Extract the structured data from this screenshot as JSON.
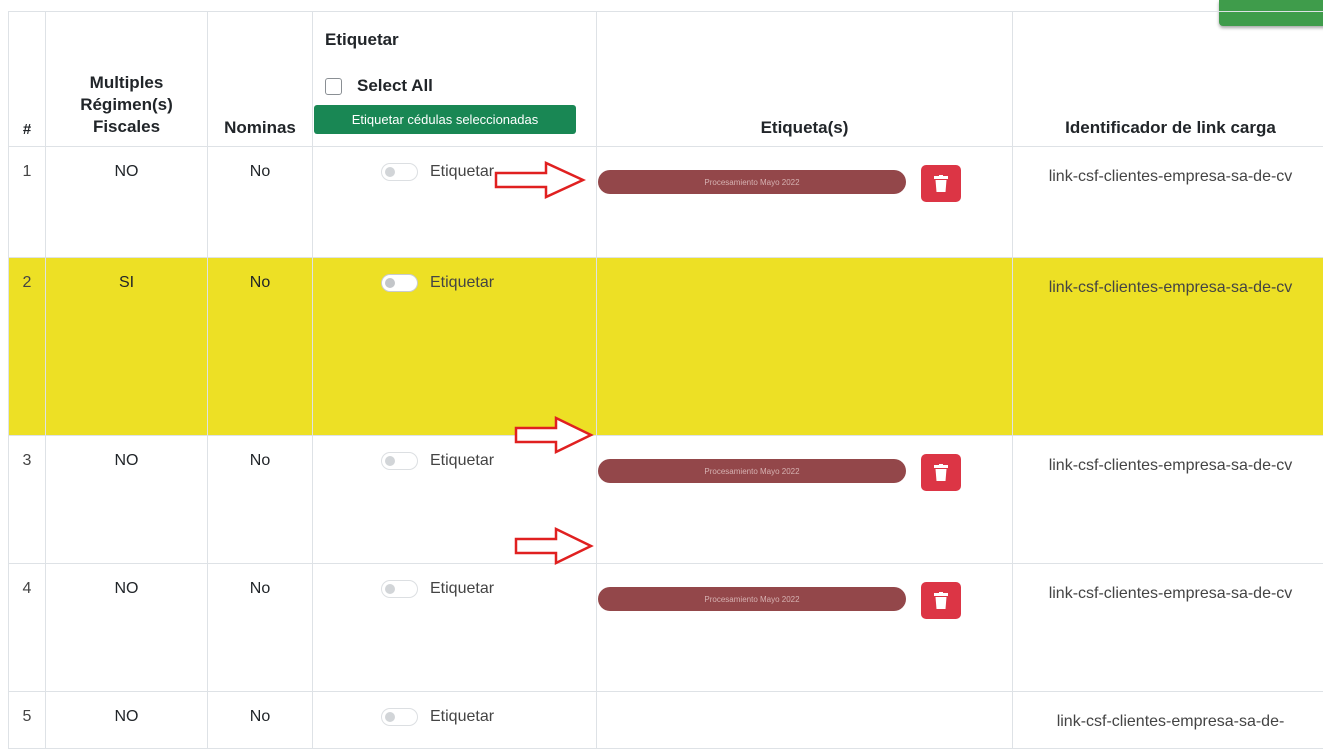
{
  "table": {
    "headers": {
      "num": "#",
      "regimen": "Multiples Régimen(s) Fiscales",
      "nominas": "Nominas",
      "etiquetar_title": "Etiquetar",
      "select_all": "Select All",
      "tag_selected_button": "Etiquetar cédulas seleccionadas",
      "etiquetas": "Etiqueta(s)",
      "identificador": "Identificador de link carga"
    },
    "rows": [
      {
        "num": "1",
        "regimen": "NO",
        "nominas": "No",
        "toggle_label": "Etiquetar",
        "tag": "Procesamiento Mayo 2022",
        "link": "link-csf-clientes-empresa-sa-de-cv"
      },
      {
        "num": "2",
        "regimen": "SI",
        "nominas": "No",
        "toggle_label": "Etiquetar",
        "tag": "",
        "link": "link-csf-clientes-empresa-sa-de-cv"
      },
      {
        "num": "3",
        "regimen": "NO",
        "nominas": "No",
        "toggle_label": "Etiquetar",
        "tag": "Procesamiento Mayo 2022",
        "link": "link-csf-clientes-empresa-sa-de-cv"
      },
      {
        "num": "4",
        "regimen": "NO",
        "nominas": "No",
        "toggle_label": "Etiquetar",
        "tag": "Procesamiento Mayo 2022",
        "link": "link-csf-clientes-empresa-sa-de-cv"
      },
      {
        "num": "5",
        "regimen": "NO",
        "nominas": "No",
        "toggle_label": "Etiquetar",
        "tag": "",
        "link": "link-csf-clientes-empresa-sa-de-"
      }
    ]
  },
  "colors": {
    "highlight_row": "#ede025",
    "tag_background": "#93474a",
    "delete_button": "#dc3545",
    "primary_button": "#198754",
    "annotation_arrow": "#e02020"
  },
  "icons": {
    "delete": "trash-icon",
    "annotation": "red-arrow-icon"
  }
}
